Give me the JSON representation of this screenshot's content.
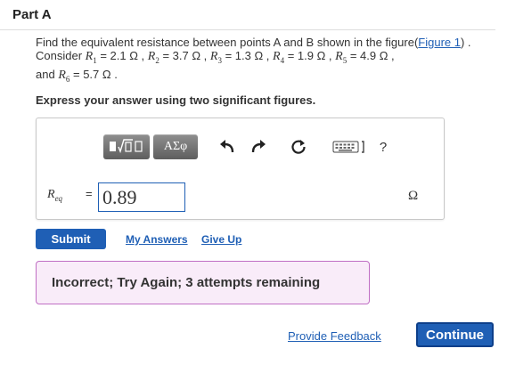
{
  "part": {
    "title": "Part A"
  },
  "question": {
    "prefix": "Find the equivalent resistance between points A and B shown in the figure(",
    "figure_link": "Figure 1",
    "middle": ") . Consider ",
    "resistors": [
      {
        "symbol": "R",
        "sub": "1",
        "value": " = 2.1 Ω , "
      },
      {
        "symbol": "R",
        "sub": "2",
        "value": " = 3.7 Ω , "
      },
      {
        "symbol": "R",
        "sub": "3",
        "value": " = 1.3 Ω , "
      },
      {
        "symbol": "R",
        "sub": "4",
        "value": " = 1.9 Ω , "
      },
      {
        "symbol": "R",
        "sub": "5",
        "value": " = 4.9 Ω ,"
      },
      {
        "symbol": "R",
        "sub": "6",
        "value": " = 5.7 Ω ."
      }
    ],
    "and_text": "and "
  },
  "instruction": "Express your answer using two significant figures.",
  "toolbar": {
    "templates_label": "▮√▯",
    "symbols_label": "ΑΣφ",
    "help_label": "?",
    "icons": [
      "templates-icon",
      "undo-icon",
      "redo-icon",
      "reset-icon",
      "keyboard-icon",
      "help-icon"
    ]
  },
  "answer": {
    "var_symbol": "R",
    "var_sub": "eq",
    "equals": "=",
    "value": "0.89",
    "unit": "Ω"
  },
  "actions": {
    "submit": "Submit",
    "my_answers": "My Answers",
    "give_up": "Give Up"
  },
  "feedback": {
    "message": "Incorrect; Try Again; 3 attempts remaining"
  },
  "footer": {
    "provide_feedback": "Provide Feedback",
    "continue": "Continue"
  },
  "colors": {
    "accent": "#1f5fb5",
    "feedback_bg": "#f9ecf9",
    "feedback_border": "#c06fc4",
    "toolbar_button": "#6e6e6e"
  }
}
